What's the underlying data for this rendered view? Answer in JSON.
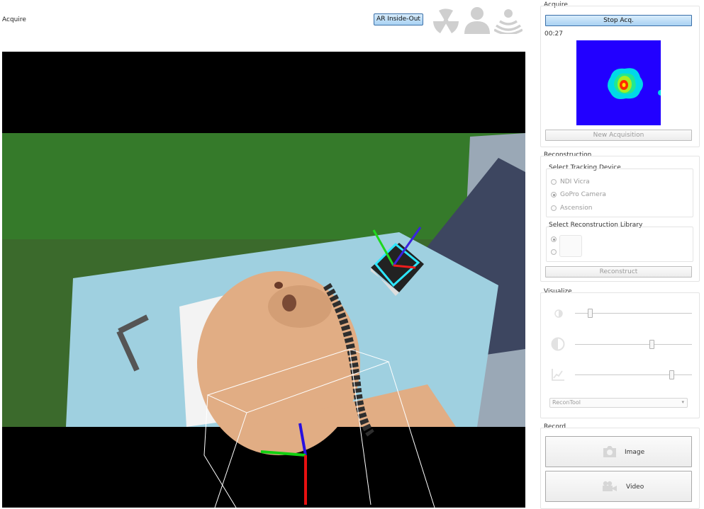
{
  "header": {
    "mode_label": "Acquire",
    "ar_button_label": "AR Inside-Out",
    "status_icons": [
      "radiation-icon",
      "person-icon",
      "signal-waves-icon"
    ]
  },
  "panel": {
    "acquire": {
      "title": "Acquire",
      "stop_button": "Stop Acq.",
      "timer": "00:27",
      "new_acq_button": "New Acquisition"
    },
    "reconstruction": {
      "title": "Reconstruction",
      "tracking_title": "Select Tracking Device",
      "devices": [
        {
          "label": "NDI Vicra",
          "selected": false
        },
        {
          "label": "GoPro Camera",
          "selected": true
        },
        {
          "label": "Ascension",
          "selected": false
        }
      ],
      "library_title": "Select Reconstruction Library",
      "reconstruct_button": "Reconstruct"
    },
    "visualize": {
      "title": "Visualize",
      "sliders": [
        {
          "icon": "brightness-icon",
          "value": 0.12
        },
        {
          "icon": "contrast-icon",
          "value": 0.65
        },
        {
          "icon": "chart-icon",
          "value": 0.88
        }
      ],
      "dropdown_value": "ReconTool"
    },
    "record": {
      "title": "Record",
      "image_button": "Image",
      "video_button": "Video"
    }
  },
  "colors": {
    "accent": "#a9d2f3",
    "heatmap_bg": "#2200ff"
  }
}
